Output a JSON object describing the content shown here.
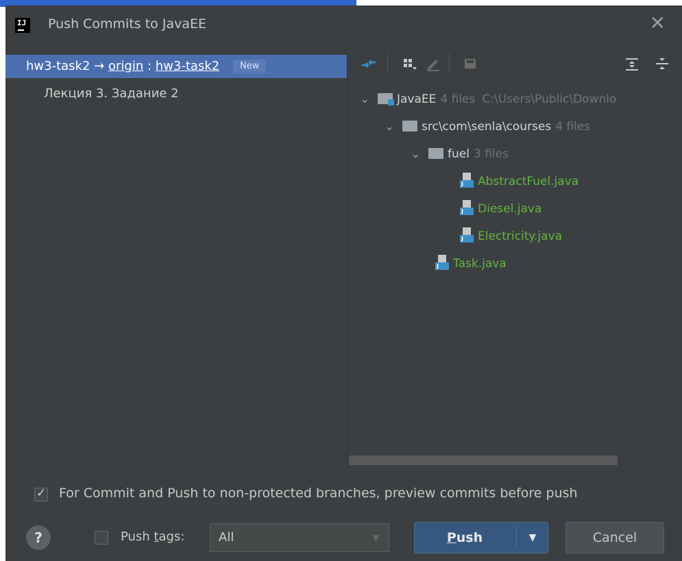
{
  "window": {
    "title": "Push Commits to JavaEE",
    "app_icon_text": "IJ"
  },
  "left": {
    "branch": {
      "local": "hw3-task2",
      "arrow": "→",
      "remote": "origin",
      "colon": ":",
      "target": "hw3-task2",
      "badge": "New"
    },
    "commits": [
      "Лекция 3. Задание 2"
    ]
  },
  "tree": {
    "root": {
      "name": "JavaEE",
      "count": "4 files",
      "path": "C:\\Users\\Public\\Downlo"
    },
    "package": {
      "name": "src\\com\\senla\\courses",
      "count": "4 files"
    },
    "folder": {
      "name": "fuel",
      "count": "3 files"
    },
    "files_in_folder": [
      "AbstractFuel.java",
      "Diesel.java",
      "Electricity.java"
    ],
    "file_in_package": "Task.java"
  },
  "bottom": {
    "preview_checkbox_checked": true,
    "preview_label": "For Commit and Push to non-protected branches, preview commits before push",
    "help_label": "?",
    "push_tags_checked": false,
    "push_tags_label_before": "Push ",
    "push_tags_label_mnemonic": "t",
    "push_tags_label_after": "ags:",
    "tags_select_value": "All",
    "push_label_mnemonic": "P",
    "push_label_rest": "ush",
    "cancel_label": "Cancel"
  },
  "colors": {
    "dialog_bg": "#3c3f41",
    "selection": "#4b6eaf",
    "new_file": "#62b543",
    "primary_button": "#365880"
  },
  "icons": {
    "toolbar": [
      "sync-icon",
      "group-by-icon",
      "edit-icon",
      "save-icon",
      "expand-all-icon",
      "collapse-all-icon"
    ]
  }
}
